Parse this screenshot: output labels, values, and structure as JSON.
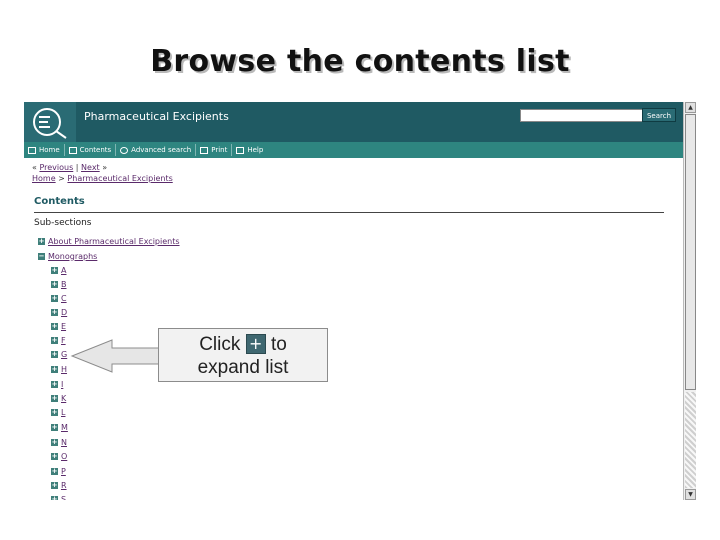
{
  "slide": {
    "title": "Browse the contents list"
  },
  "header": {
    "site_title": "Pharmaceutical Excipients",
    "logo_icon": "eq-logo-icon",
    "search_placeholder": "",
    "search_button": "Search"
  },
  "nav": [
    {
      "label": "Home",
      "icon": "home-icon"
    },
    {
      "label": "Contents",
      "icon": "list-icon"
    },
    {
      "label": "Advanced search",
      "icon": "magnifier-icon"
    },
    {
      "label": "Print",
      "icon": "printer-icon"
    },
    {
      "label": "Help",
      "icon": "help-icon"
    }
  ],
  "breadcrumb": {
    "pager_prev_symbol": "«",
    "pager_prev": "Previous",
    "pager_next": "Next",
    "pager_next_symbol": "»",
    "home": "Home",
    "separator": ">",
    "current": "Pharmaceutical Excipients"
  },
  "contents": {
    "heading": "Contents",
    "subsections_label": "Sub-sections",
    "tree": [
      {
        "label": "About Pharmaceutical Excipients",
        "state": "+",
        "level": 0
      },
      {
        "label": "Monographs",
        "state": "−",
        "level": 0
      },
      {
        "label": "A",
        "state": "+",
        "level": 1
      },
      {
        "label": "B",
        "state": "+",
        "level": 1
      },
      {
        "label": "C",
        "state": "+",
        "level": 1
      },
      {
        "label": "D",
        "state": "+",
        "level": 1
      },
      {
        "label": "E",
        "state": "+",
        "level": 1
      },
      {
        "label": "F",
        "state": "+",
        "level": 1
      },
      {
        "label": "G",
        "state": "+",
        "level": 1
      },
      {
        "label": "H",
        "state": "+",
        "level": 1
      },
      {
        "label": "I",
        "state": "+",
        "level": 1
      },
      {
        "label": "K",
        "state": "+",
        "level": 1
      },
      {
        "label": "L",
        "state": "+",
        "level": 1
      },
      {
        "label": "M",
        "state": "+",
        "level": 1
      },
      {
        "label": "N",
        "state": "+",
        "level": 1
      },
      {
        "label": "O",
        "state": "+",
        "level": 1
      },
      {
        "label": "P",
        "state": "+",
        "level": 1
      },
      {
        "label": "R",
        "state": "+",
        "level": 1
      },
      {
        "label": "S",
        "state": "+",
        "level": 1
      }
    ]
  },
  "callout": {
    "line1_prefix": "Click",
    "plus_symbol": "+",
    "line1_suffix": "to",
    "line2": "expand list"
  },
  "colors": {
    "header_bg": "#1f5a63",
    "nav_bg": "#2e8580",
    "link": "#5a2a6a",
    "expander": "#3f7f7a"
  }
}
